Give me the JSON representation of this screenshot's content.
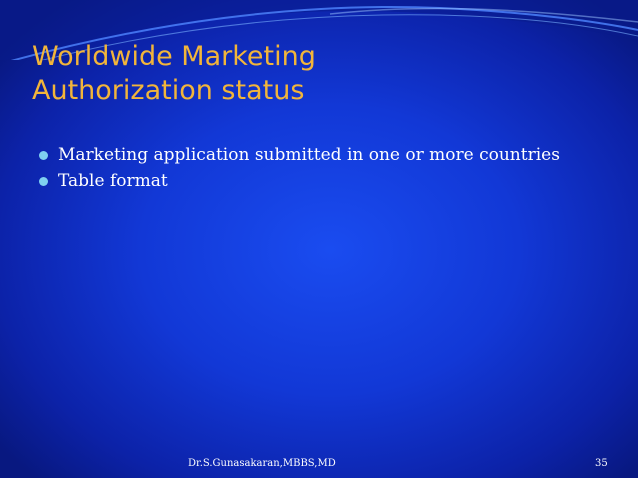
{
  "slide": {
    "title_lines": [
      "Worldwide Marketing",
      "Authorization status"
    ],
    "bullets": [
      "Marketing application submitted in one or more countries",
      "Table format"
    ],
    "footer_author": "Dr.S.Gunasakaran,MBBS,MD",
    "page_number": "35"
  },
  "colors": {
    "background": "#1238d6",
    "title": "#f2b53a",
    "bullet_text": "#ffffff",
    "bullet_marker": "#7fd0f0"
  }
}
